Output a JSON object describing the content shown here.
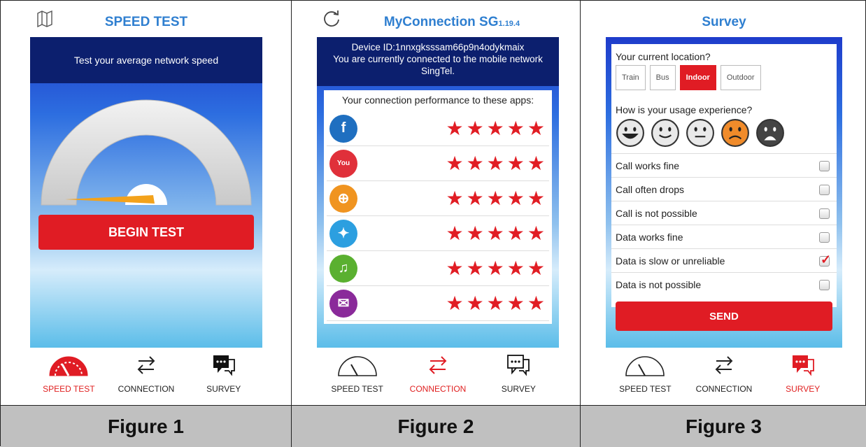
{
  "figure1": {
    "title": "SPEED TEST",
    "subtitle": "Test your average network speed",
    "begin_label": "BEGIN TEST",
    "caption": "Figure 1",
    "nav": [
      "SPEED TEST",
      "CONNECTION",
      "SURVEY"
    ],
    "active_nav": 0
  },
  "figure2": {
    "title": "MyConnection SG",
    "version": "1.19.4",
    "device_line": "Device ID:1nnxgksssam66p9n4odykmaix",
    "network_line": "You are currently connected to the mobile network SingTel.",
    "performance_label": "Your connection performance to these apps:",
    "apps": [
      {
        "icon": "facebook-icon",
        "color": "#1f6fc0",
        "glyph": "f",
        "rating": 5
      },
      {
        "icon": "youtube-icon",
        "color": "#e0303a",
        "glyph": "You",
        "rating": 5
      },
      {
        "icon": "web-icon",
        "color": "#f09420",
        "glyph": "⊕",
        "rating": 5
      },
      {
        "icon": "twitter-icon",
        "color": "#2c9fe0",
        "glyph": "✦",
        "rating": 5
      },
      {
        "icon": "music-icon",
        "color": "#5ab030",
        "glyph": "♫",
        "rating": 5
      },
      {
        "icon": "email-icon",
        "color": "#8a2a9a",
        "glyph": "✉",
        "rating": 5
      }
    ],
    "caption": "Figure 2",
    "nav": [
      "SPEED TEST",
      "CONNECTION",
      "SURVEY"
    ],
    "active_nav": 1
  },
  "figure3": {
    "title": "Survey",
    "location_label": "Your current location?",
    "locations": [
      "Train",
      "Bus",
      "Indoor",
      "Outdoor"
    ],
    "selected_location": "Indoor",
    "experience_label": "How is your usage experience?",
    "faces": [
      "very-happy-face-icon",
      "happy-face-icon",
      "neutral-face-icon",
      "sad-face-icon",
      "angry-face-icon"
    ],
    "selected_face": "sad-face-icon",
    "options": [
      {
        "label": "Call works fine",
        "checked": false
      },
      {
        "label": "Call often drops",
        "checked": false
      },
      {
        "label": "Call is not possible",
        "checked": false
      },
      {
        "label": "Data works fine",
        "checked": false
      },
      {
        "label": "Data is slow or unreliable",
        "checked": true
      },
      {
        "label": "Data is not possible",
        "checked": false
      }
    ],
    "send_label": "SEND",
    "caption": "Figure 3",
    "nav": [
      "SPEED TEST",
      "CONNECTION",
      "SURVEY"
    ],
    "active_nav": 2
  }
}
